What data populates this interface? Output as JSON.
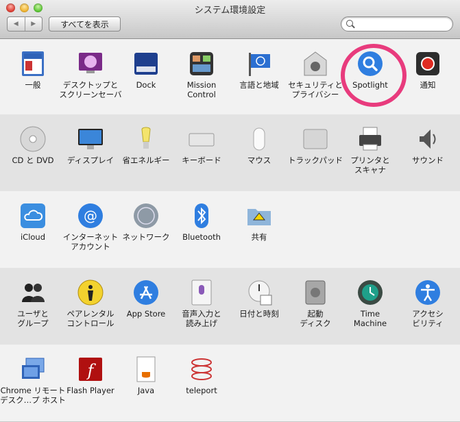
{
  "window": {
    "title": "システム環境設定"
  },
  "toolbar": {
    "back": "◀",
    "forward": "▶",
    "show_all": "すべてを表示",
    "search_value": ""
  },
  "rows": [
    {
      "panes": [
        {
          "label": "一般",
          "icon": "general-icon"
        },
        {
          "label": "デスクトップと\nスクリーンセーバ",
          "icon": "desktop-screensaver-icon"
        },
        {
          "label": "Dock",
          "icon": "dock-icon"
        },
        {
          "label": "Mission\nControl",
          "icon": "mission-control-icon"
        },
        {
          "label": "言語と地域",
          "icon": "language-region-icon"
        },
        {
          "label": "セキュリティと\nプライバシー",
          "icon": "security-privacy-icon"
        },
        {
          "label": "Spotlight",
          "icon": "spotlight-icon"
        },
        {
          "label": "通知",
          "icon": "notifications-icon"
        }
      ]
    },
    {
      "panes": [
        {
          "label": "CD と DVD",
          "icon": "cd-dvd-icon"
        },
        {
          "label": "ディスプレイ",
          "icon": "displays-icon"
        },
        {
          "label": "省エネルギー",
          "icon": "energy-saver-icon"
        },
        {
          "label": "キーボード",
          "icon": "keyboard-icon"
        },
        {
          "label": "マウス",
          "icon": "mouse-icon"
        },
        {
          "label": "トラックパッド",
          "icon": "trackpad-icon"
        },
        {
          "label": "プリンタと\nスキャナ",
          "icon": "printer-scanner-icon"
        },
        {
          "label": "サウンド",
          "icon": "sound-icon"
        }
      ]
    },
    {
      "panes": [
        {
          "label": "iCloud",
          "icon": "icloud-icon"
        },
        {
          "label": "インターネット\nアカウント",
          "icon": "internet-accounts-icon"
        },
        {
          "label": "ネットワーク",
          "icon": "network-icon"
        },
        {
          "label": "Bluetooth",
          "icon": "bluetooth-icon"
        },
        {
          "label": "共有",
          "icon": "sharing-icon"
        }
      ]
    },
    {
      "panes": [
        {
          "label": "ユーザと\nグループ",
          "icon": "users-groups-icon"
        },
        {
          "label": "ペアレンタル\nコントロール",
          "icon": "parental-controls-icon"
        },
        {
          "label": "App Store",
          "icon": "app-store-icon"
        },
        {
          "label": "音声入力と\n読み上げ",
          "icon": "dictation-speech-icon"
        },
        {
          "label": "日付と時刻",
          "icon": "date-time-icon"
        },
        {
          "label": "起動\nディスク",
          "icon": "startup-disk-icon"
        },
        {
          "label": "Time\nMachine",
          "icon": "time-machine-icon"
        },
        {
          "label": "アクセシ\nビリティ",
          "icon": "accessibility-icon"
        }
      ]
    },
    {
      "panes": [
        {
          "label": "Chrome リモート\nデスク…プ ホスト",
          "icon": "chrome-remote-desktop-icon"
        },
        {
          "label": "Flash Player",
          "icon": "flash-player-icon"
        },
        {
          "label": "Java",
          "icon": "java-icon"
        },
        {
          "label": "teleport",
          "icon": "teleport-icon"
        }
      ]
    }
  ],
  "highlight": {
    "target": "Spotlight",
    "color": "#e83b7d"
  }
}
